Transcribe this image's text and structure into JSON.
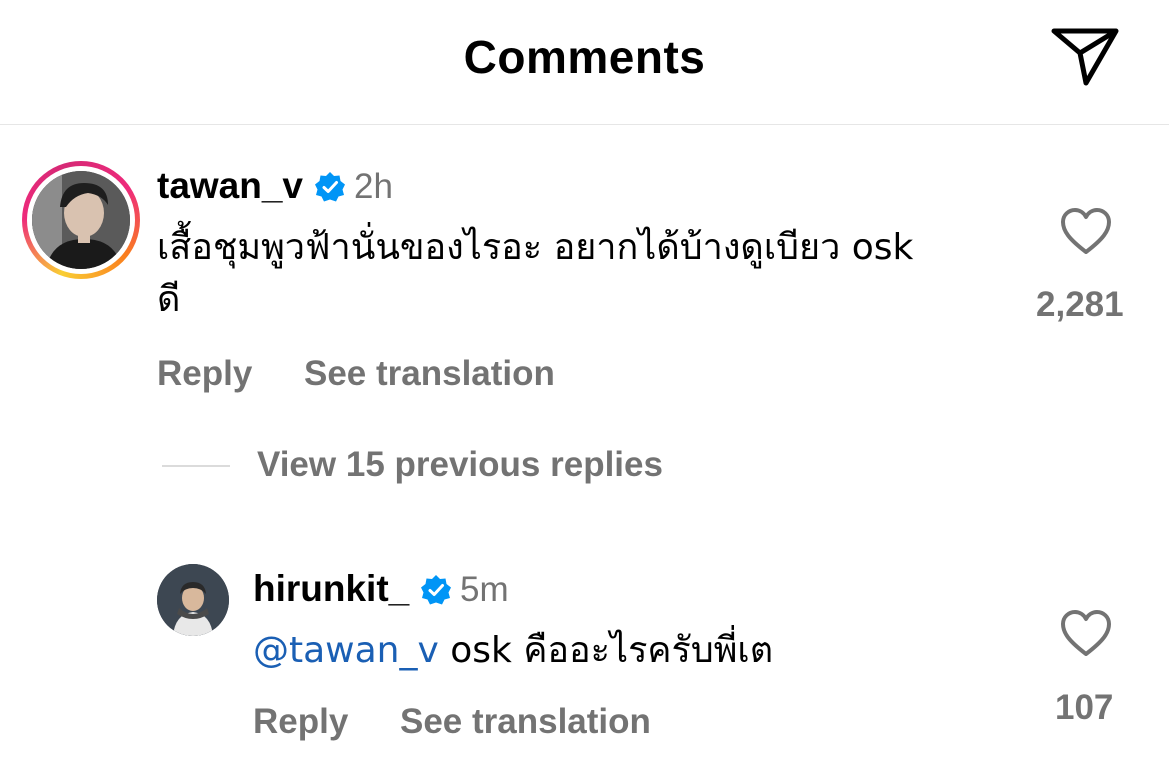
{
  "header": {
    "title": "Comments",
    "share_icon": "paper-plane-icon"
  },
  "comments": [
    {
      "username": "tawan_v",
      "verified": true,
      "time": "2h",
      "text_line1": "เสื้อชุมพูวฟ้านั่นของไรอะ อยากได้บ้างดูเบียว osk",
      "text_line2": "ดี",
      "reply_label": "Reply",
      "translate_label": "See translation",
      "likes": "2,281",
      "has_story_ring": true
    }
  ],
  "view_replies_label": "View 15 previous replies",
  "replies": [
    {
      "username": "hirunkit_",
      "verified": true,
      "time": "5m",
      "mention": "@tawan_v",
      "text": " osk คืออะไรครับพี่เต",
      "reply_label": "Reply",
      "translate_label": "See translation",
      "likes": "107"
    }
  ],
  "colors": {
    "verified_blue": "#0095f6",
    "secondary_text": "#737373",
    "mention_blue": "#1a5fb4"
  }
}
